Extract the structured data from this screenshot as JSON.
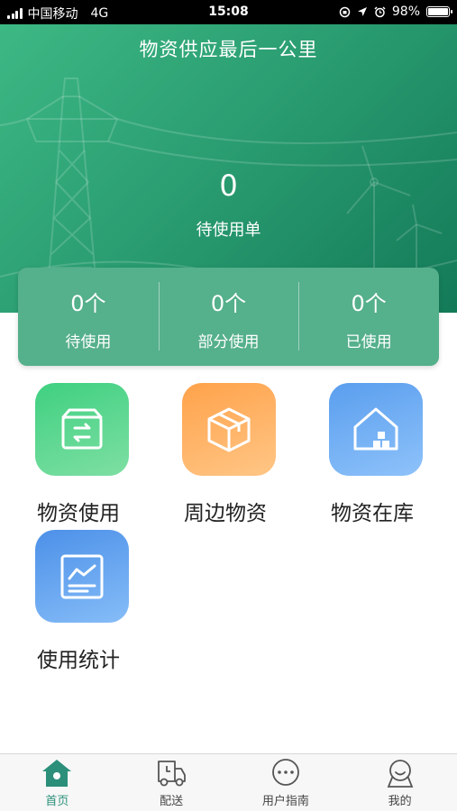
{
  "status_bar": {
    "carrier": "中国移动",
    "network": "4G",
    "time": "15:08",
    "battery": "98%",
    "battery_level": 0.98
  },
  "header": {
    "title": "物资供应最后一公里",
    "pending_count": "0",
    "pending_label": "待使用单"
  },
  "stats": [
    {
      "value": "0个",
      "label": "待使用"
    },
    {
      "value": "0个",
      "label": "部分使用"
    },
    {
      "value": "0个",
      "label": "已使用"
    }
  ],
  "menu": [
    {
      "label": "物资使用",
      "icon": "box-transfer-icon",
      "color": "#3fd081"
    },
    {
      "label": "周边物资",
      "icon": "cube-icon",
      "color": "#ffa24a"
    },
    {
      "label": "物资在库",
      "icon": "warehouse-icon",
      "color": "#5a9eee"
    },
    {
      "label": "使用统计",
      "icon": "chart-icon",
      "color": "#4c90e8"
    }
  ],
  "tabs": [
    {
      "label": "首页",
      "icon": "home-icon",
      "active": true
    },
    {
      "label": "配送",
      "icon": "truck-icon",
      "active": false
    },
    {
      "label": "用户指南",
      "icon": "chat-icon",
      "active": false
    },
    {
      "label": "我的",
      "icon": "user-icon",
      "active": false
    }
  ],
  "colors": {
    "accent": "#2b8f7a",
    "hero_start": "#3db884",
    "hero_end": "#137a58",
    "card": "#55b08c"
  }
}
